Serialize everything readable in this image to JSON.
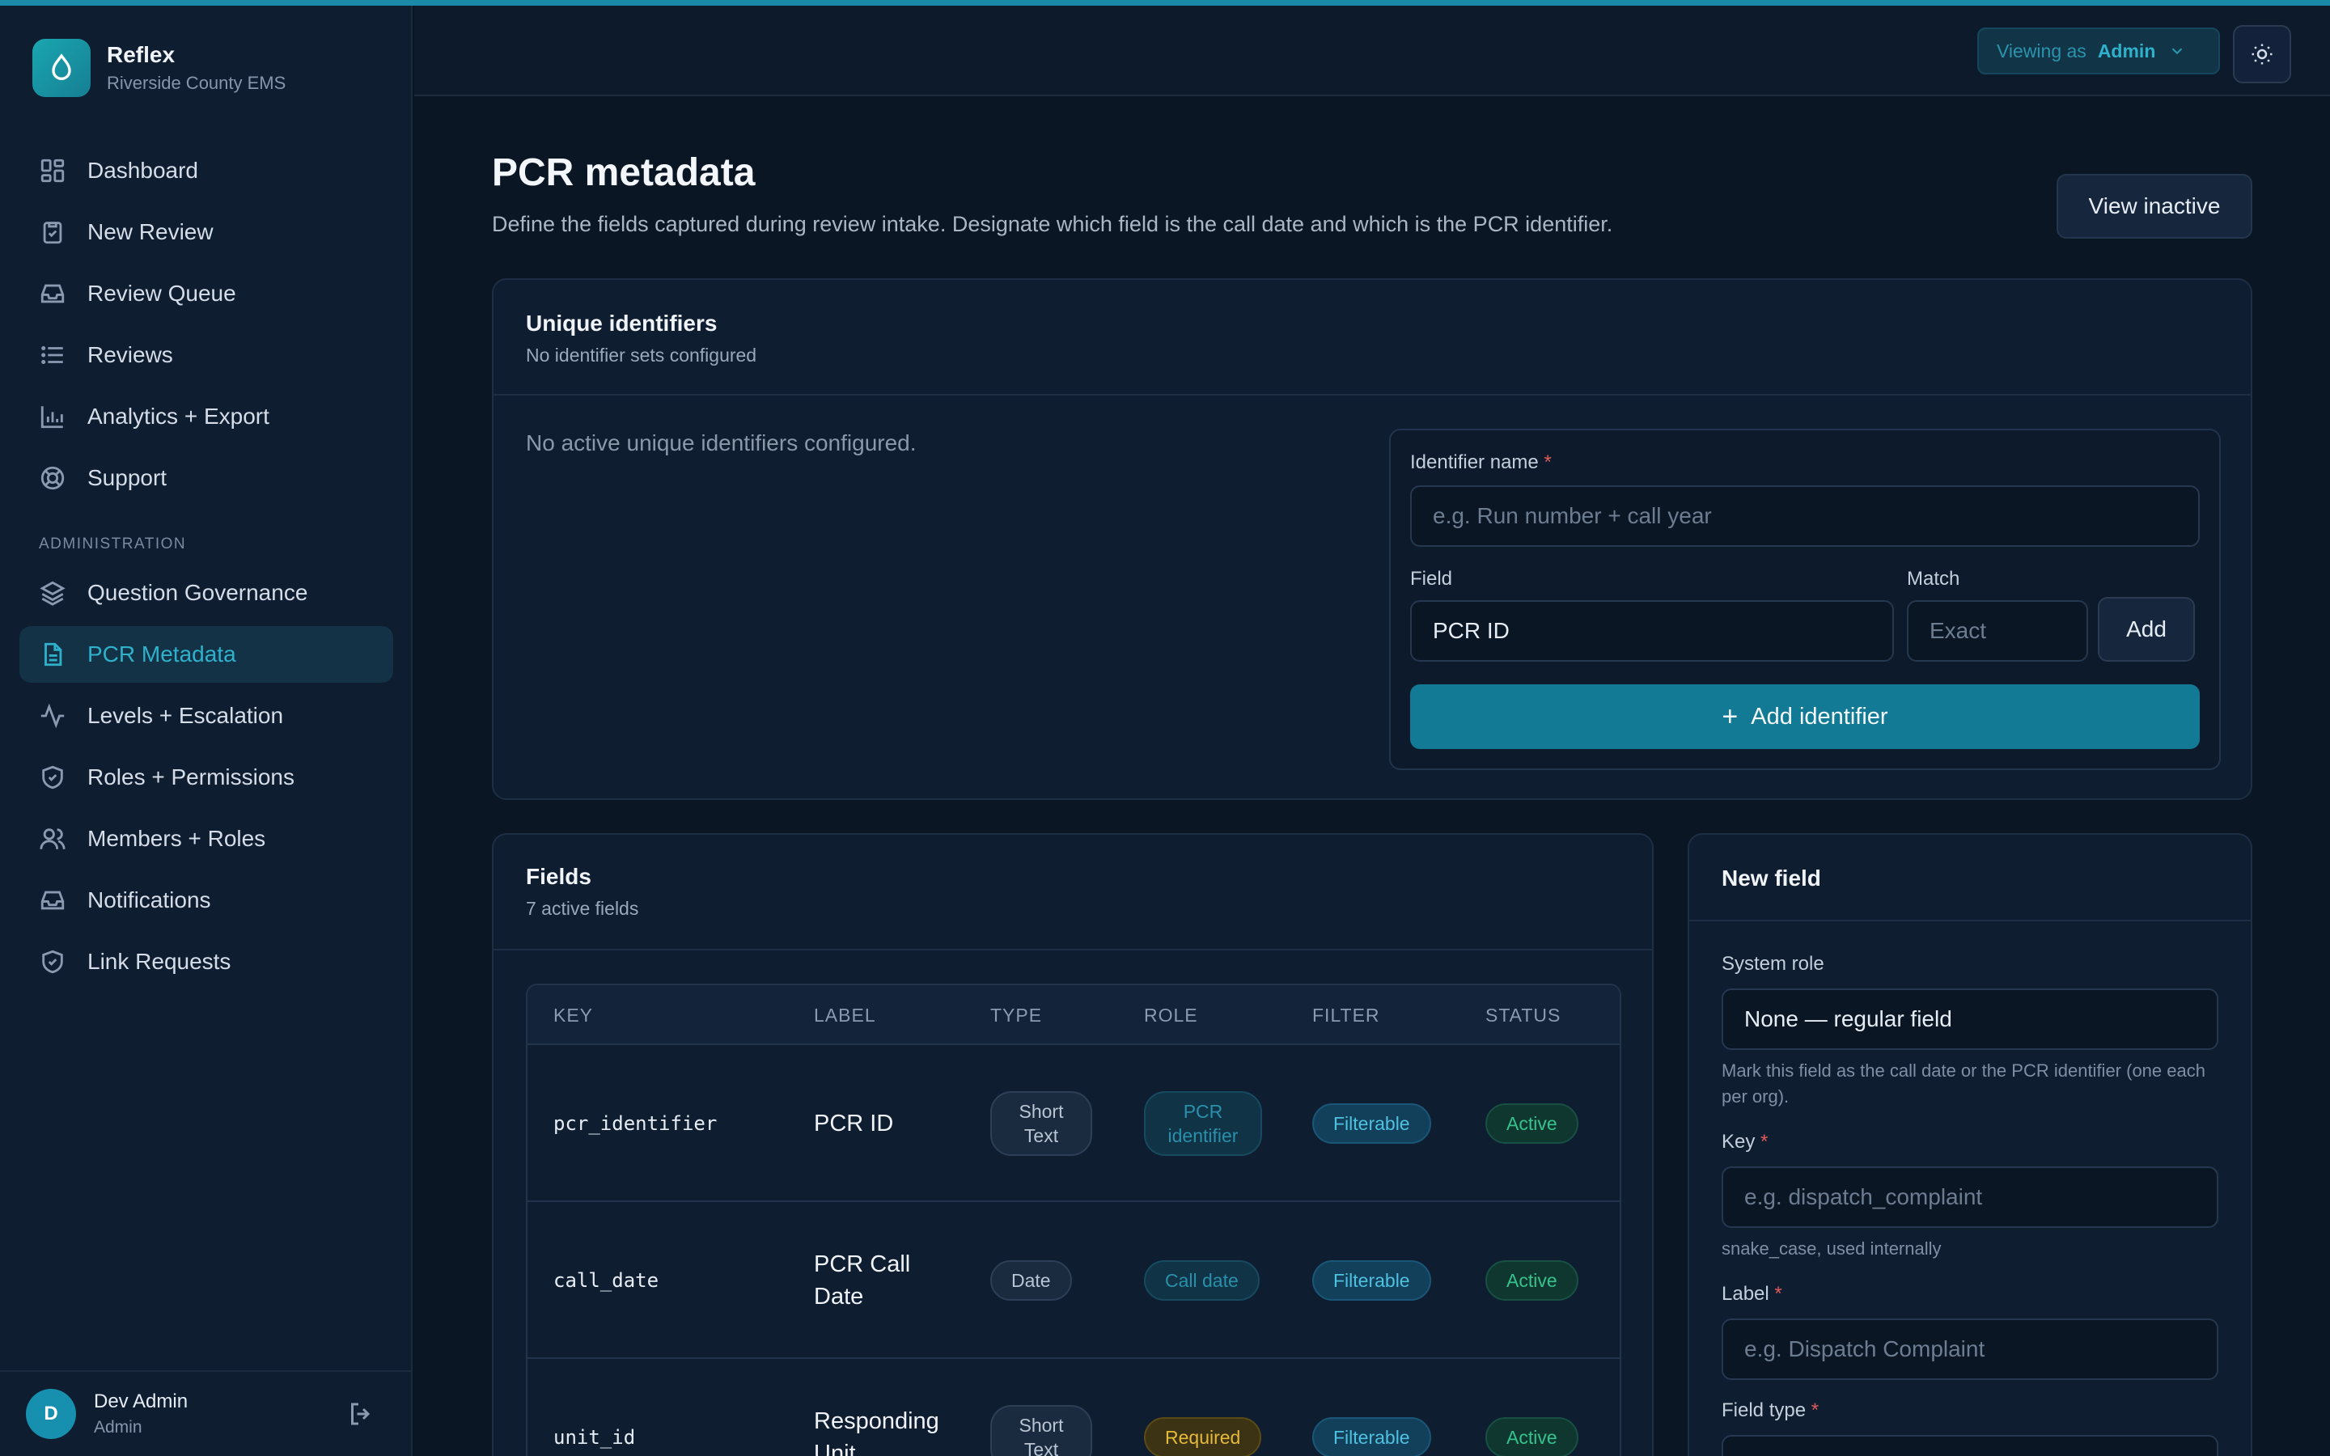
{
  "brand": {
    "name": "Reflex",
    "org": "Riverside County EMS"
  },
  "nav": {
    "main": [
      {
        "label": "Dashboard",
        "icon": "dashboard-icon"
      },
      {
        "label": "New Review",
        "icon": "clipboard-check-icon"
      },
      {
        "label": "Review Queue",
        "icon": "inbox-icon"
      },
      {
        "label": "Reviews",
        "icon": "list-icon"
      },
      {
        "label": "Analytics + Export",
        "icon": "bar-chart-icon"
      },
      {
        "label": "Support",
        "icon": "lifebuoy-icon"
      }
    ],
    "section_label": "ADMINISTRATION",
    "admin": [
      {
        "label": "Question Governance",
        "icon": "layers-icon"
      },
      {
        "label": "PCR Metadata",
        "icon": "file-icon",
        "active": true
      },
      {
        "label": "Levels + Escalation",
        "icon": "activity-icon"
      },
      {
        "label": "Roles + Permissions",
        "icon": "shield-check-icon"
      },
      {
        "label": "Members + Roles",
        "icon": "users-icon"
      },
      {
        "label": "Notifications",
        "icon": "inbox-icon"
      },
      {
        "label": "Link Requests",
        "icon": "shield-check-icon"
      }
    ]
  },
  "user": {
    "initial": "D",
    "name": "Dev Admin",
    "role": "Admin"
  },
  "header": {
    "viewing_label": "Viewing as",
    "viewing_value": "Admin"
  },
  "page": {
    "title": "PCR metadata",
    "description": "Define the fields captured during review intake. Designate which field is the call date and which is the PCR identifier.",
    "view_inactive": "View inactive"
  },
  "unique_identifiers": {
    "title": "Unique identifiers",
    "subtitle": "No identifier sets configured",
    "empty": "No active unique identifiers configured.",
    "form": {
      "name_label": "Identifier name",
      "name_placeholder": "e.g. Run number + call year",
      "field_label": "Field",
      "field_value": "PCR ID",
      "match_label": "Match",
      "match_placeholder": "Exact",
      "add_label": "Add",
      "add_identifier_label": "Add identifier"
    }
  },
  "fields": {
    "title": "Fields",
    "subtitle": "7 active fields",
    "columns": [
      "KEY",
      "LABEL",
      "TYPE",
      "ROLE",
      "FILTER",
      "STATUS"
    ],
    "rows": [
      {
        "key": "pcr_identifier",
        "label": "PCR ID",
        "type": "Short Text",
        "role": "PCR identifier",
        "role_kind": "role",
        "filter": "Filterable",
        "status": "Active"
      },
      {
        "key": "call_date",
        "label": "PCR Call Date",
        "type": "Date",
        "role": "Call date",
        "role_kind": "role",
        "filter": "Filterable",
        "status": "Active"
      },
      {
        "key": "unit_id",
        "label": "Responding Unit",
        "type": "Short Text",
        "role": "Required",
        "role_kind": "required",
        "filter": "Filterable",
        "status": "Active"
      }
    ]
  },
  "new_field": {
    "title": "New field",
    "system_role_label": "System role",
    "system_role_value": "None — regular field",
    "system_role_help": "Mark this field as the call date or the PCR identifier (one each per org).",
    "key_label": "Key",
    "key_placeholder": "e.g. dispatch_complaint",
    "key_help": "snake_case, used internally",
    "label_label": "Label",
    "label_placeholder": "e.g. Dispatch Complaint",
    "field_type_label": "Field type"
  },
  "colors": {
    "accent": "#137a95",
    "active_nav": "#2fb1cc",
    "background": "#0b1625"
  }
}
